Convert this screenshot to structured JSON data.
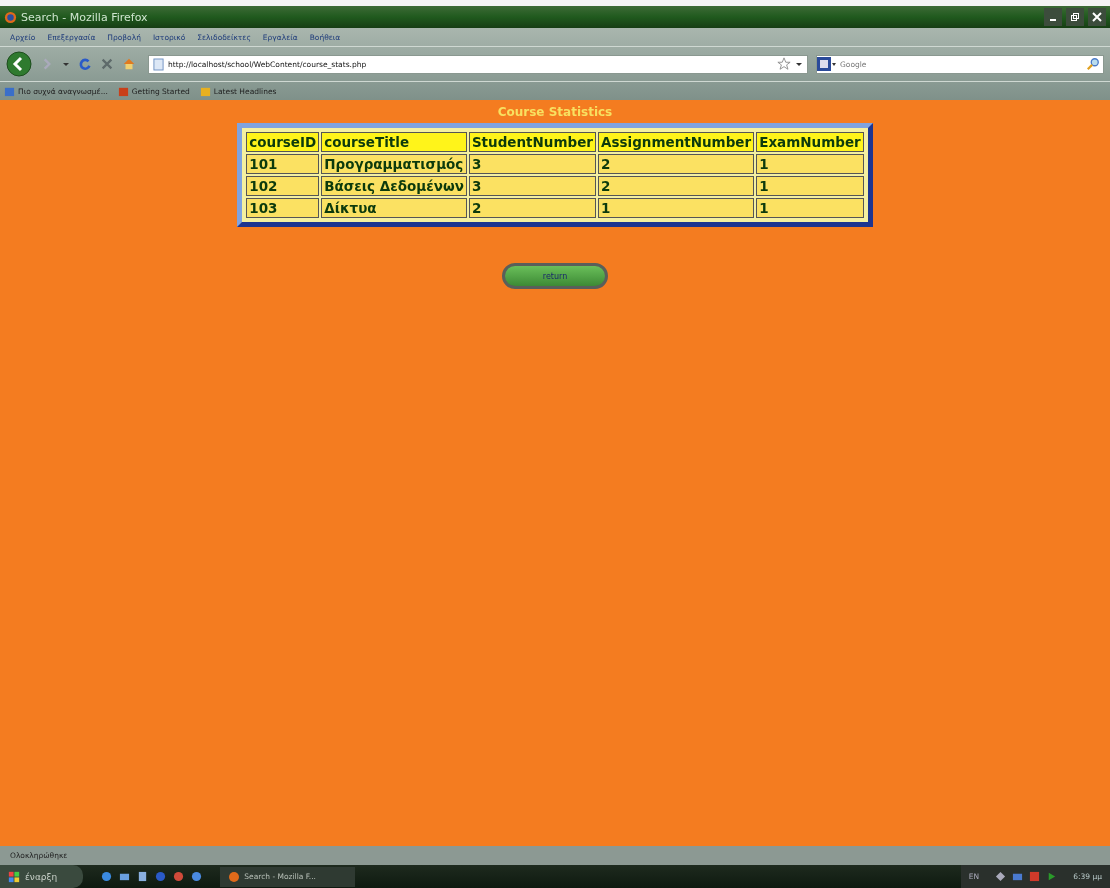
{
  "window": {
    "title": "Search - Mozilla Firefox"
  },
  "menu": [
    "Αρχείο",
    "Επεξεργασία",
    "Προβολή",
    "Ιστορικό",
    "Σελιδοδείκτες",
    "Εργαλεία",
    "Βοήθεια"
  ],
  "address_bar": {
    "value": "http://localhost/school/WebContent/course_stats.php"
  },
  "search": {
    "placeholder": "Google"
  },
  "bookmarks": [
    {
      "label": "Πιο συχνά αναγνωσμέ...",
      "kind": "folder"
    },
    {
      "label": "Getting Started",
      "kind": "page"
    },
    {
      "label": "Latest Headlines",
      "kind": "feed"
    }
  ],
  "page": {
    "heading": "Course Statistics",
    "table": {
      "columns": [
        "courseID",
        "courseTitle",
        "StudentNumber",
        "AssignmentNumber",
        "ExamNumber"
      ],
      "rows": [
        [
          "101",
          "Προγραμματισμός",
          "3",
          "2",
          "1"
        ],
        [
          "102",
          "Βάσεις Δεδομένων",
          "3",
          "2",
          "1"
        ],
        [
          "103",
          "Δίκτυα",
          "2",
          "1",
          "1"
        ]
      ]
    },
    "button": "return"
  },
  "status_bar": "Ολοκληρώθηκε",
  "taskbar": {
    "start": "έναρξη",
    "window_button": "Search - Mozilla F...",
    "language": "EN",
    "clock": "6:39 μμ"
  }
}
